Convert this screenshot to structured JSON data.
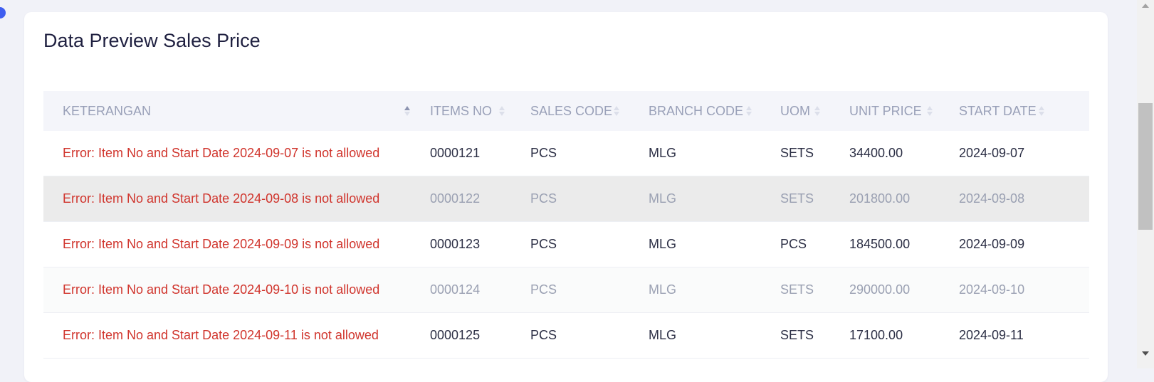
{
  "card": {
    "title": "Data Preview Sales Price"
  },
  "table": {
    "columns": [
      {
        "label": "KETERANGAN",
        "sort": "asc"
      },
      {
        "label": "ITEMS NO",
        "sort": "none"
      },
      {
        "label": "SALES CODE",
        "sort": "none"
      },
      {
        "label": "BRANCH CODE",
        "sort": "none"
      },
      {
        "label": "UOM",
        "sort": "none"
      },
      {
        "label": "UNIT PRICE",
        "sort": "none"
      },
      {
        "label": "START DATE",
        "sort": "none"
      }
    ],
    "rows": [
      [
        "Error: Item No and Start Date 2024-09-07 is not allowed",
        "0000121",
        "PCS",
        "MLG",
        "SETS",
        "34400.00",
        "2024-09-07"
      ],
      [
        "Error: Item No and Start Date 2024-09-08 is not allowed",
        "0000122",
        "PCS",
        "MLG",
        "SETS",
        "201800.00",
        "2024-09-08"
      ],
      [
        "Error: Item No and Start Date 2024-09-09 is not allowed",
        "0000123",
        "PCS",
        "MLG",
        "PCS",
        "184500.00",
        "2024-09-09"
      ],
      [
        "Error: Item No and Start Date 2024-09-10 is not allowed",
        "0000124",
        "PCS",
        "MLG",
        "SETS",
        "290000.00",
        "2024-09-10"
      ],
      [
        "Error: Item No and Start Date 2024-09-11 is not allowed",
        "0000125",
        "PCS",
        "MLG",
        "SETS",
        "17100.00",
        "2024-09-11"
      ]
    ]
  },
  "colors": {
    "error": "#d0342c",
    "accent": "#3f5ef0"
  },
  "icons": {
    "sort": "sort-arrows-icon",
    "scroll_up": "scroll-up-arrow-icon",
    "scroll_down": "scroll-down-arrow-icon"
  }
}
